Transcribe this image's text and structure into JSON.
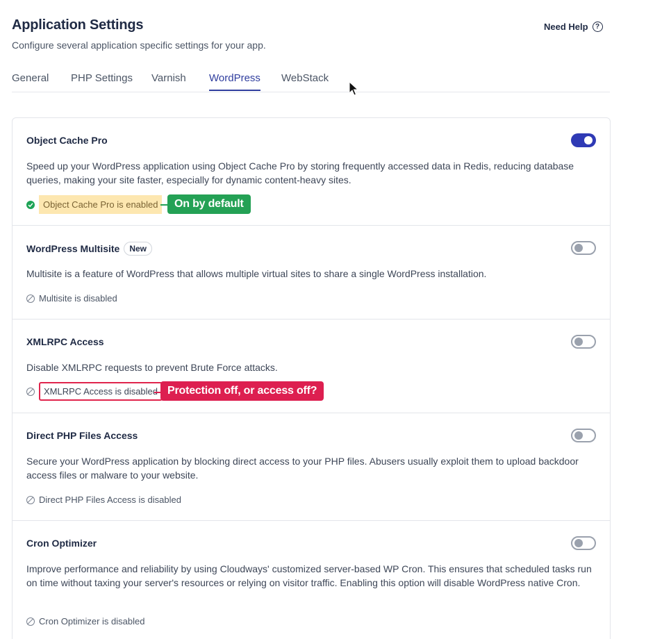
{
  "header": {
    "title": "Application Settings",
    "subtitle": "Configure several application specific settings for your app.",
    "need_help": "Need Help"
  },
  "tabs": [
    {
      "label": "General",
      "active": false
    },
    {
      "label": "PHP Settings",
      "active": false
    },
    {
      "label": "Varnish",
      "active": false
    },
    {
      "label": "WordPress",
      "active": true
    },
    {
      "label": "WebStack",
      "active": false
    }
  ],
  "sections": [
    {
      "title": "Object Cache Pro",
      "enabled": true,
      "description": "Speed up your WordPress application using Object Cache Pro by storing frequently accessed data in Redis, reducing database queries, making your site faster, especially for dynamic content-heavy sites.",
      "status": "Object Cache Pro is enabled",
      "status_icon": "check-circle-icon"
    },
    {
      "title": "WordPress Multisite",
      "badge": "New",
      "enabled": false,
      "description": "Multisite is a feature of WordPress that allows multiple virtual sites to share a single WordPress installation.",
      "status": "Multisite is disabled",
      "status_icon": "ban-icon"
    },
    {
      "title": "XMLRPC Access",
      "enabled": false,
      "description": "Disable XMLRPC requests to prevent Brute Force attacks.",
      "status": "XMLRPC Access is disabled",
      "status_icon": "ban-icon"
    },
    {
      "title": "Direct PHP Files Access",
      "enabled": false,
      "description": "Secure your WordPress application by blocking direct access to your PHP files. Abusers usually exploit them to upload backdoor access files or malware to your website.",
      "status": "Direct PHP Files Access is disabled",
      "status_icon": "ban-icon"
    },
    {
      "title": "Cron Optimizer",
      "enabled": false,
      "description": "Improve performance and reliability by using Cloudways' customized server-based WP Cron. This ensures that scheduled tasks run on time without taxing your server's resources or relying on visitor traffic. Enabling this option will disable WordPress native Cron.",
      "status": "Cron Optimizer is disabled",
      "status_icon": "ban-icon"
    }
  ],
  "annotations": {
    "on_by_default": "On by default",
    "protection_question": "Protection off, or access off?"
  },
  "colors": {
    "accent": "#2f3ab5",
    "tab_active": "#2f3d9e",
    "callout_green": "#24a155",
    "callout_red": "#dd1f50",
    "enabled_highlight": "#fde7b0"
  }
}
